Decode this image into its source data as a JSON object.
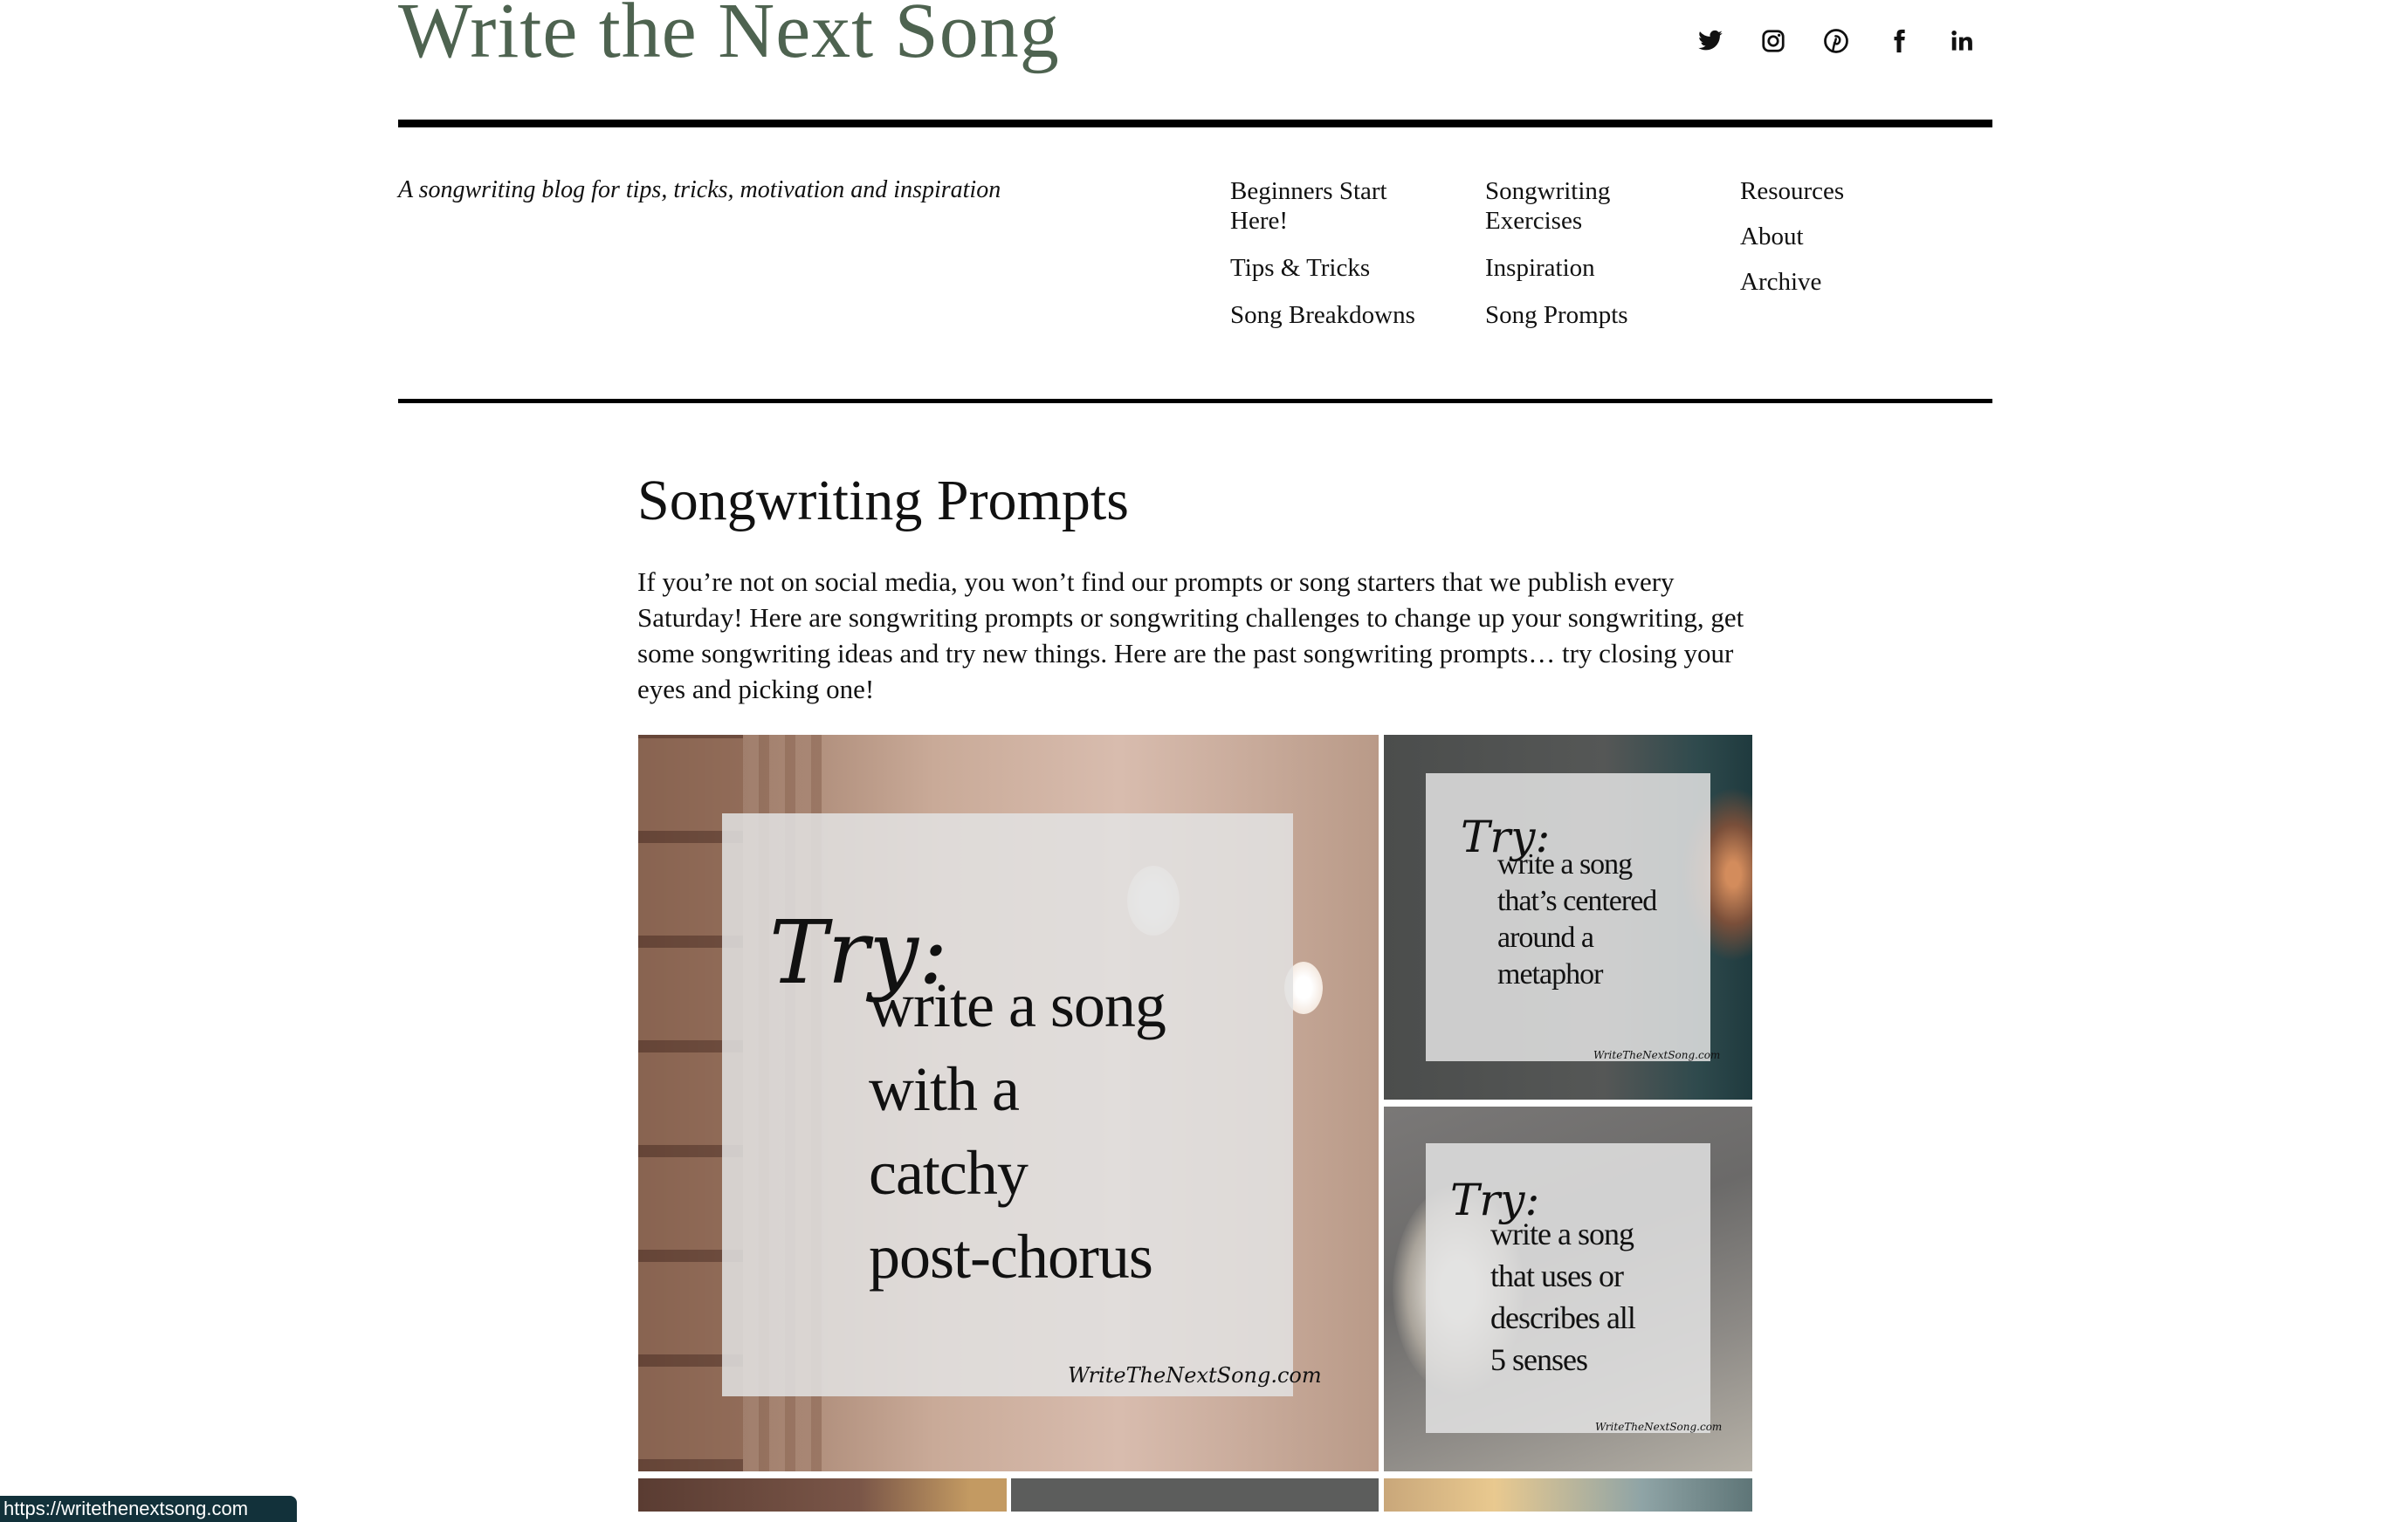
{
  "site": {
    "title": "Write the Next Song",
    "tagline": "A songwriting blog for tips, tricks, motivation and inspiration",
    "social": [
      {
        "name": "twitter-icon"
      },
      {
        "name": "instagram-icon"
      },
      {
        "name": "pinterest-icon"
      },
      {
        "name": "facebook-icon"
      },
      {
        "name": "linkedin-icon"
      }
    ]
  },
  "nav": {
    "col1": [
      "Beginners Start Here!",
      "Tips & Tricks",
      "Song Breakdowns"
    ],
    "col2": [
      "Songwriting Exercises",
      "Inspiration",
      "Song Prompts"
    ],
    "col3": [
      "Resources",
      "About",
      "Archive"
    ]
  },
  "page": {
    "heading": "Songwriting Prompts",
    "intro": "If you’re not on social media, you won’t find our prompts or song starters that we publish every Saturday! Here are songwriting prompts or songwriting challenges to change up your songwriting, get some songwriting ideas and try new things. Here are the past songwriting prompts… try closing your eyes and picking one!"
  },
  "prompts": [
    {
      "try": "Try:",
      "text": "write a song\nwith a\ncatchy\npost-chorus",
      "signature": "WriteTheNextSong.com"
    },
    {
      "try": "Try:",
      "text": "write a song\nthat’s centered\naround a\nmetaphor",
      "signature": "WriteTheNextSong.com"
    },
    {
      "try": "Try:",
      "text": "write a song\nthat uses or\ndescribes all\n5 senses",
      "signature": "WriteTheNextSong.com"
    }
  ],
  "status_bar": {
    "url": "https://writethenextsong.com"
  },
  "colors": {
    "title": "#4e6350",
    "rule": "#000000",
    "status_bg": "#12313a"
  }
}
